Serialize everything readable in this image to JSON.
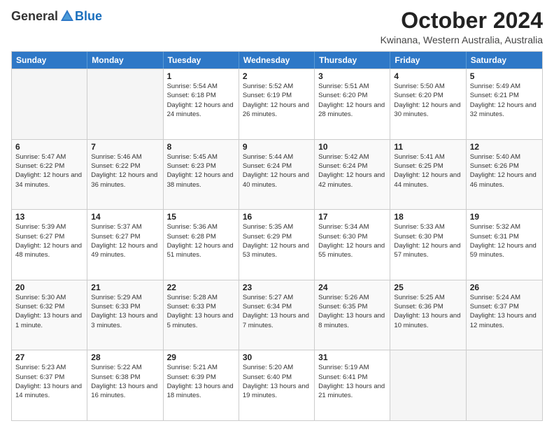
{
  "logo": {
    "general": "General",
    "blue": "Blue"
  },
  "title": "October 2024",
  "subtitle": "Kwinana, Western Australia, Australia",
  "days": [
    "Sunday",
    "Monday",
    "Tuesday",
    "Wednesday",
    "Thursday",
    "Friday",
    "Saturday"
  ],
  "weeks": [
    [
      {
        "day": "",
        "info": ""
      },
      {
        "day": "",
        "info": ""
      },
      {
        "day": "1",
        "info": "Sunrise: 5:54 AM\nSunset: 6:18 PM\nDaylight: 12 hours and 24 minutes."
      },
      {
        "day": "2",
        "info": "Sunrise: 5:52 AM\nSunset: 6:19 PM\nDaylight: 12 hours and 26 minutes."
      },
      {
        "day": "3",
        "info": "Sunrise: 5:51 AM\nSunset: 6:20 PM\nDaylight: 12 hours and 28 minutes."
      },
      {
        "day": "4",
        "info": "Sunrise: 5:50 AM\nSunset: 6:20 PM\nDaylight: 12 hours and 30 minutes."
      },
      {
        "day": "5",
        "info": "Sunrise: 5:49 AM\nSunset: 6:21 PM\nDaylight: 12 hours and 32 minutes."
      }
    ],
    [
      {
        "day": "6",
        "info": "Sunrise: 5:47 AM\nSunset: 6:22 PM\nDaylight: 12 hours and 34 minutes."
      },
      {
        "day": "7",
        "info": "Sunrise: 5:46 AM\nSunset: 6:22 PM\nDaylight: 12 hours and 36 minutes."
      },
      {
        "day": "8",
        "info": "Sunrise: 5:45 AM\nSunset: 6:23 PM\nDaylight: 12 hours and 38 minutes."
      },
      {
        "day": "9",
        "info": "Sunrise: 5:44 AM\nSunset: 6:24 PM\nDaylight: 12 hours and 40 minutes."
      },
      {
        "day": "10",
        "info": "Sunrise: 5:42 AM\nSunset: 6:24 PM\nDaylight: 12 hours and 42 minutes."
      },
      {
        "day": "11",
        "info": "Sunrise: 5:41 AM\nSunset: 6:25 PM\nDaylight: 12 hours and 44 minutes."
      },
      {
        "day": "12",
        "info": "Sunrise: 5:40 AM\nSunset: 6:26 PM\nDaylight: 12 hours and 46 minutes."
      }
    ],
    [
      {
        "day": "13",
        "info": "Sunrise: 5:39 AM\nSunset: 6:27 PM\nDaylight: 12 hours and 48 minutes."
      },
      {
        "day": "14",
        "info": "Sunrise: 5:37 AM\nSunset: 6:27 PM\nDaylight: 12 hours and 49 minutes."
      },
      {
        "day": "15",
        "info": "Sunrise: 5:36 AM\nSunset: 6:28 PM\nDaylight: 12 hours and 51 minutes."
      },
      {
        "day": "16",
        "info": "Sunrise: 5:35 AM\nSunset: 6:29 PM\nDaylight: 12 hours and 53 minutes."
      },
      {
        "day": "17",
        "info": "Sunrise: 5:34 AM\nSunset: 6:30 PM\nDaylight: 12 hours and 55 minutes."
      },
      {
        "day": "18",
        "info": "Sunrise: 5:33 AM\nSunset: 6:30 PM\nDaylight: 12 hours and 57 minutes."
      },
      {
        "day": "19",
        "info": "Sunrise: 5:32 AM\nSunset: 6:31 PM\nDaylight: 12 hours and 59 minutes."
      }
    ],
    [
      {
        "day": "20",
        "info": "Sunrise: 5:30 AM\nSunset: 6:32 PM\nDaylight: 13 hours and 1 minute."
      },
      {
        "day": "21",
        "info": "Sunrise: 5:29 AM\nSunset: 6:33 PM\nDaylight: 13 hours and 3 minutes."
      },
      {
        "day": "22",
        "info": "Sunrise: 5:28 AM\nSunset: 6:33 PM\nDaylight: 13 hours and 5 minutes."
      },
      {
        "day": "23",
        "info": "Sunrise: 5:27 AM\nSunset: 6:34 PM\nDaylight: 13 hours and 7 minutes."
      },
      {
        "day": "24",
        "info": "Sunrise: 5:26 AM\nSunset: 6:35 PM\nDaylight: 13 hours and 8 minutes."
      },
      {
        "day": "25",
        "info": "Sunrise: 5:25 AM\nSunset: 6:36 PM\nDaylight: 13 hours and 10 minutes."
      },
      {
        "day": "26",
        "info": "Sunrise: 5:24 AM\nSunset: 6:37 PM\nDaylight: 13 hours and 12 minutes."
      }
    ],
    [
      {
        "day": "27",
        "info": "Sunrise: 5:23 AM\nSunset: 6:37 PM\nDaylight: 13 hours and 14 minutes."
      },
      {
        "day": "28",
        "info": "Sunrise: 5:22 AM\nSunset: 6:38 PM\nDaylight: 13 hours and 16 minutes."
      },
      {
        "day": "29",
        "info": "Sunrise: 5:21 AM\nSunset: 6:39 PM\nDaylight: 13 hours and 18 minutes."
      },
      {
        "day": "30",
        "info": "Sunrise: 5:20 AM\nSunset: 6:40 PM\nDaylight: 13 hours and 19 minutes."
      },
      {
        "day": "31",
        "info": "Sunrise: 5:19 AM\nSunset: 6:41 PM\nDaylight: 13 hours and 21 minutes."
      },
      {
        "day": "",
        "info": ""
      },
      {
        "day": "",
        "info": ""
      }
    ]
  ],
  "row_alt": [
    false,
    true,
    false,
    true,
    false
  ]
}
